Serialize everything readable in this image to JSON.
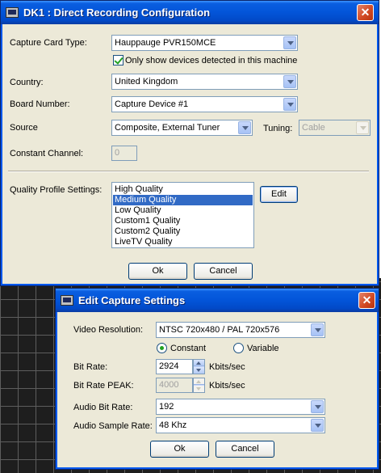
{
  "main_dialog": {
    "title": "DK1 : Direct Recording Configuration",
    "close_symbol": "✕",
    "capture_card_label": "Capture Card Type:",
    "capture_card_value": "Hauppauge PVR150MCE",
    "only_show_detected_label": "Only show devices detected in this machine",
    "only_show_detected_checked": true,
    "country_label": "Country:",
    "country_value": "United Kingdom",
    "board_number_label": "Board Number:",
    "board_number_value": "Capture Device #1",
    "source_label": "Source",
    "source_value": "Composite, External Tuner",
    "tuning_label": "Tuning:",
    "tuning_value": "Cable",
    "constant_channel_label": "Constant Channel:",
    "constant_channel_value": "0",
    "quality_profile_label": "Quality Profile Settings:",
    "quality_profiles": [
      "High Quality",
      "Medium Quality",
      "Low Quality",
      "Custom1 Quality",
      "Custom2 Quality",
      "LiveTV Quality"
    ],
    "selected_profile": "Medium Quality",
    "edit_button": "Edit",
    "ok_button": "Ok",
    "cancel_button": "Cancel"
  },
  "edit_dialog": {
    "title": "Edit Capture Settings",
    "close_symbol": "✕",
    "video_resolution_label": "Video Resolution:",
    "video_resolution_value": "NTSC 720x480 / PAL 720x576",
    "mode_constant_label": "Constant",
    "mode_variable_label": "Variable",
    "mode_selected": "Constant",
    "bit_rate_label": "Bit Rate:",
    "bit_rate_value": "2924",
    "bit_rate_unit": "Kbits/sec",
    "bit_rate_peak_label": "Bit Rate PEAK:",
    "bit_rate_peak_value": "4000",
    "bit_rate_peak_unit": "Kbits/sec",
    "audio_bit_rate_label": "Audio Bit Rate:",
    "audio_bit_rate_value": "192",
    "audio_sample_rate_label": "Audio Sample Rate:",
    "audio_sample_rate_value": "48 Khz",
    "ok_button": "Ok",
    "cancel_button": "Cancel"
  },
  "colors": {
    "title_bar": "#0355d9",
    "dialog_face": "#ece9d8",
    "selection": "#316ac5",
    "close_button": "#d24a24"
  },
  "icons": {
    "window_icon": "monitor-icon",
    "dropdown_icon": "chevron-down-icon",
    "close_icon": "close-icon"
  }
}
